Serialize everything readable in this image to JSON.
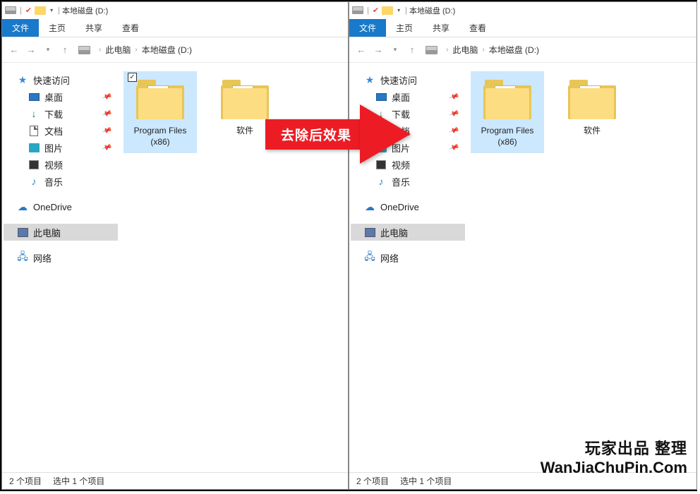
{
  "window_title": "本地磁盘 (D:)",
  "ribbon": {
    "file": "文件",
    "home": "主页",
    "share": "共享",
    "view": "查看"
  },
  "breadcrumb": {
    "pc": "此电脑",
    "drive": "本地磁盘 (D:)"
  },
  "sidebar": {
    "quick_access": "快速访问",
    "desktop": "桌面",
    "downloads": "下载",
    "documents": "文档",
    "pictures": "图片",
    "videos": "视频",
    "music": "音乐",
    "onedrive": "OneDrive",
    "this_pc": "此电脑",
    "network": "网络"
  },
  "folders": [
    {
      "name": "Program Files (x86)",
      "selected": true
    },
    {
      "name": "软件",
      "selected": false
    }
  ],
  "status": {
    "items": "2 个项目",
    "selected": "选中 1 个项目"
  },
  "callout": "去除后效果",
  "left_has_checkbox": true,
  "watermark": {
    "line1": "玩家出品 整理",
    "line2": "WanJiaChuPin.Com"
  }
}
